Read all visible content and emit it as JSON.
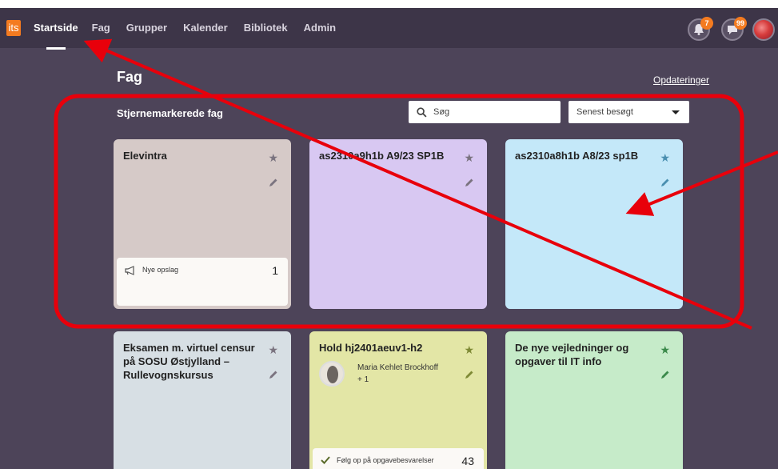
{
  "app": {
    "logo_text": "its"
  },
  "nav": {
    "items": [
      "Startside",
      "Fag",
      "Grupper",
      "Kalender",
      "Bibliotek",
      "Admin"
    ],
    "active": "Startside"
  },
  "notifications": {
    "bell_count": "7",
    "messages_count": "99"
  },
  "page": {
    "title": "Fag",
    "updates_link": "Opdateringer",
    "section_title": "Stjernemarkerede fag",
    "search_placeholder": "Søg",
    "sort_select": "Senest besøgt"
  },
  "cards": [
    {
      "title": "Elevintra",
      "color": "#d6cac8",
      "star_color": "#7a737f",
      "notif_label": "Nye opslag",
      "notif_count": "1"
    },
    {
      "title": "as2310a9h1b A9/23 SP1B",
      "color": "#d8c8f2",
      "star_color": "#7a737f"
    },
    {
      "title": "as2310a8h1b A8/23 sp1B",
      "color": "#c4e8f9",
      "star_color": "#4a8fb0"
    },
    {
      "title": "Eksamen m. virtuel censur på SOSU Østjylland – Rullevognskursus",
      "color": "#d7dfe4",
      "star_color": "#7a737f"
    },
    {
      "title": "Hold hj2401aeuv1-h2",
      "color": "#e3e6a6",
      "star_color": "#7f8a35",
      "teacher_name": "Maria Kehlet Brockhoff",
      "teacher_extra": "+ 1",
      "notif_label": "Følg op på opgavebesvarelser",
      "notif_count": "43"
    },
    {
      "title": "De nye vejledninger og opgaver til IT info",
      "color": "#c6ebc9",
      "star_color": "#3b8a4b"
    }
  ],
  "annotation": {
    "color": "#e8000b"
  }
}
